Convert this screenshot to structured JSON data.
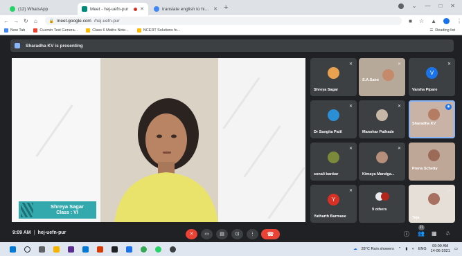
{
  "browser": {
    "tabs": [
      {
        "label": "(12) WhatsApp",
        "color": "#25d366"
      },
      {
        "label": "Meet - hej-uefn-pur",
        "color": "#00897b",
        "active": true
      },
      {
        "label": "translate english to hindi - Goog",
        "color": "#4285f4"
      }
    ],
    "new_tab": "+",
    "url_host": "meet.google.com",
    "url_path": "/hej-uefn-pur",
    "bookmarks": [
      {
        "label": "New Tab",
        "color": "#4285f4"
      },
      {
        "label": "Cuemin Test Genera...",
        "color": "#ea4335"
      },
      {
        "label": "Class 6 Maths Note...",
        "color": "#fbbc04"
      },
      {
        "label": "NCERT Solutions fo...",
        "color": "#fbbc04"
      }
    ],
    "reading_list": "Reading list"
  },
  "meet": {
    "presenting_banner": "Sharadha KV is presenting",
    "main_speaker": {
      "name": "Shreya Sagar",
      "class": "Class : VI"
    },
    "tiles": [
      {
        "name": "Shreya Sagar",
        "kind": "avatar",
        "color": "#e8a24f"
      },
      {
        "name": "S.A.Saini",
        "kind": "video"
      },
      {
        "name": "Varsha Pipare",
        "kind": "letter",
        "letter": "V",
        "color": "#1a73e8"
      },
      {
        "name": "Dr Sangita Patil",
        "kind": "avatar",
        "color": "#2b8fd6"
      },
      {
        "name": "Manohar Pathade",
        "kind": "avatar",
        "color": "#c7b7a6"
      },
      {
        "name": "Sharadha KV",
        "kind": "video",
        "active": true
      },
      {
        "name": "sonali bankar",
        "kind": "avatar",
        "color": "#7a8a3a"
      },
      {
        "name": "Kimaya Mandga...",
        "kind": "avatar",
        "color": "#b58f7a"
      },
      {
        "name": "Prena Schetty",
        "kind": "video"
      },
      {
        "name": "Yatharth Barmase",
        "kind": "letter",
        "letter": "Y",
        "color": "#d93025"
      },
      {
        "name": "9 others",
        "kind": "others"
      },
      {
        "name": "Teja",
        "kind": "video"
      }
    ],
    "time": "9:09 AM",
    "meeting_code": "hej-uefn-pur",
    "people_count": "21"
  },
  "taskbar": {
    "weather": "28°C  Rain showers",
    "lang": "ENG",
    "time": "09:09 AM",
    "date": "14-06-2021"
  }
}
